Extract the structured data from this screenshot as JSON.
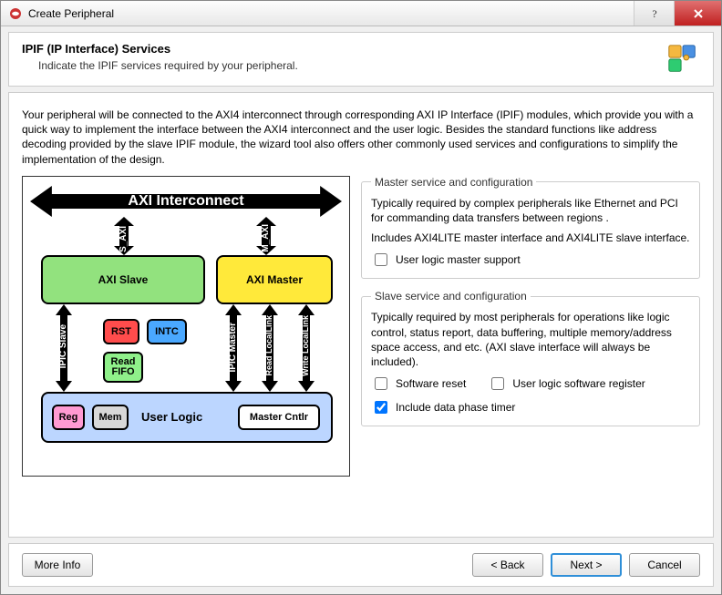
{
  "window": {
    "title": "Create Peripheral"
  },
  "header": {
    "title": "IPIF (IP Interface) Services",
    "subtitle": "Indicate the IPIF services required by your peripheral."
  },
  "intro": "Your peripheral will be connected to the AXI4 interconnect through corresponding AXI IP Interface (IPIF) modules, which provide you with a quick way to implement the interface between the AXI4 interconnect and the user logic. Besides the standard functions like address decoding provided by the slave IPIF module, the wizard tool also offers other commonly used services and configurations to simplify the implementation of the design.",
  "diagram": {
    "interconnect": "AXI Interconnect",
    "s_axi": "S_AXI",
    "m_axi": "M_AXI",
    "axi_slave": "AXI Slave",
    "axi_master": "AXI Master",
    "ipic_slave": "IPIC Slave",
    "ipic_master": "IPIC Master",
    "read_ll": "Read LocalLink",
    "write_ll": "Write LocalLink",
    "rst": "RST",
    "intc": "INTC",
    "read_fifo": "Read FIFO",
    "reg": "Reg",
    "mem": "Mem",
    "user_logic": "User Logic",
    "master_cntlr": "Master Cntlr"
  },
  "master_group": {
    "legend": "Master service and configuration",
    "desc1": "Typically required by complex peripherals like Ethernet and PCI for commanding data transfers between regions .",
    "desc2": "Includes AXI4LITE master interface and AXI4LITE slave interface.",
    "chk_master": "User logic master support",
    "chk_master_val": false
  },
  "slave_group": {
    "legend": "Slave service and configuration",
    "desc": "Typically required by most peripherals for operations like logic control, status report, data buffering, multiple memory/address space access, and etc. (AXI slave interface will always be included).",
    "chk_swreset": "Software reset",
    "chk_swreset_val": false,
    "chk_swreg": "User logic software register",
    "chk_swreg_val": false,
    "chk_phase": "Include data phase timer",
    "chk_phase_val": true
  },
  "buttons": {
    "more_info": "More Info",
    "back": "< Back",
    "next": "Next >",
    "cancel": "Cancel"
  }
}
